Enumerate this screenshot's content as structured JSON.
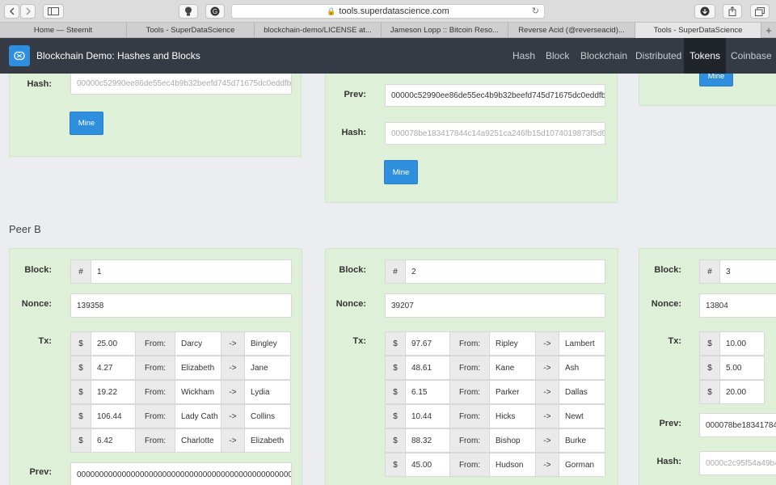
{
  "browser": {
    "url": "tools.superdatascience.com",
    "tabs": [
      "Home — Steemit",
      "Tools - SuperDataScience",
      "blockchain-demo/LICENSE at...",
      "Jameson Lopp :: Bitcoin Reso...",
      "Reverse Acid (@reverseacid)...",
      "Tools - SuperDataScience"
    ],
    "new_tab": "+"
  },
  "app": {
    "title": "Blockchain Demo: Hashes and Blocks",
    "nav": [
      "Hash",
      "Block",
      "Blockchain",
      "Distributed",
      "Tokens",
      "Coinbase"
    ],
    "active_nav": "Tokens"
  },
  "labels": {
    "hash": "Hash:",
    "prev": "Prev:",
    "block": "Block:",
    "nonce": "Nonce:",
    "tx": "Tx:",
    "mine": "Mine",
    "hash_prefix": "#",
    "currency": "$",
    "from": "From:",
    "arrow": "->"
  },
  "peer_a_partial": {
    "card1": {
      "hash": "00000c52990ee86de55ec4b9b32beefd745d71675dc0eddfb"
    },
    "card2": {
      "prev": "00000c52990ee86de55ec4b9b32beefd745d71675dc0eddfb",
      "hash": "000078be183417844c14a9251ca246fb15d1074019873f5d6"
    }
  },
  "peer_b": {
    "title": "Peer B",
    "blocks": [
      {
        "block": "1",
        "nonce": "139358",
        "tx": [
          {
            "amount": "25.00",
            "from": "Darcy",
            "to": "Bingley"
          },
          {
            "amount": "4.27",
            "from": "Elizabeth",
            "to": "Jane"
          },
          {
            "amount": "19.22",
            "from": "Wickham",
            "to": "Lydia"
          },
          {
            "amount": "106.44",
            "from": "Lady Cath",
            "to": "Collins"
          },
          {
            "amount": "6.42",
            "from": "Charlotte",
            "to": "Elizabeth"
          }
        ],
        "prev": "0000000000000000000000000000000000000000000000000"
      },
      {
        "block": "2",
        "nonce": "39207",
        "tx": [
          {
            "amount": "97.67",
            "from": "Ripley",
            "to": "Lambert"
          },
          {
            "amount": "48.61",
            "from": "Kane",
            "to": "Ash"
          },
          {
            "amount": "6.15",
            "from": "Parker",
            "to": "Dallas"
          },
          {
            "amount": "10.44",
            "from": "Hicks",
            "to": "Newt"
          },
          {
            "amount": "88.32",
            "from": "Bishop",
            "to": "Burke"
          },
          {
            "amount": "45.00",
            "from": "Hudson",
            "to": "Gorman"
          }
        ]
      },
      {
        "block": "3",
        "nonce": "13804",
        "tx": [
          {
            "amount": "10.00"
          },
          {
            "amount": "5.00"
          },
          {
            "amount": "20.00"
          }
        ],
        "prev": "000078be18341784",
        "hash": "0000c2c95f54a49b4"
      }
    ]
  }
}
